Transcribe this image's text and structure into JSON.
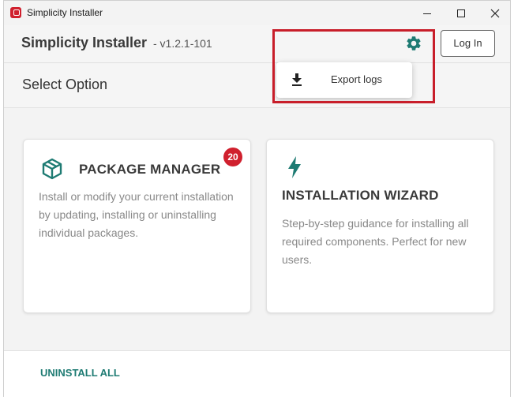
{
  "window": {
    "title": "Simplicity Installer"
  },
  "header": {
    "title": "Simplicity Installer",
    "version": "- v1.2.1-101",
    "login_label": "Log In"
  },
  "section": {
    "title": "Select Option"
  },
  "cards": [
    {
      "title": "PACKAGE MANAGER",
      "description": "Install or modify your current installation by updating, installing or uninstalling individual packages.",
      "badge": "20",
      "icon": "package-icon"
    },
    {
      "title": "INSTALLATION WIZARD",
      "description": "Step-by-step guidance for installing all required components. Perfect for new users.",
      "icon": "lightning-bolt-icon"
    }
  ],
  "footer": {
    "uninstall_label": "UNINSTALL ALL"
  },
  "menu": {
    "items": [
      {
        "label": "Export logs",
        "icon": "download-icon"
      }
    ]
  },
  "colors": {
    "accent": "#1e7b73",
    "badge": "#d0202e",
    "highlight": "#c81e2a"
  }
}
